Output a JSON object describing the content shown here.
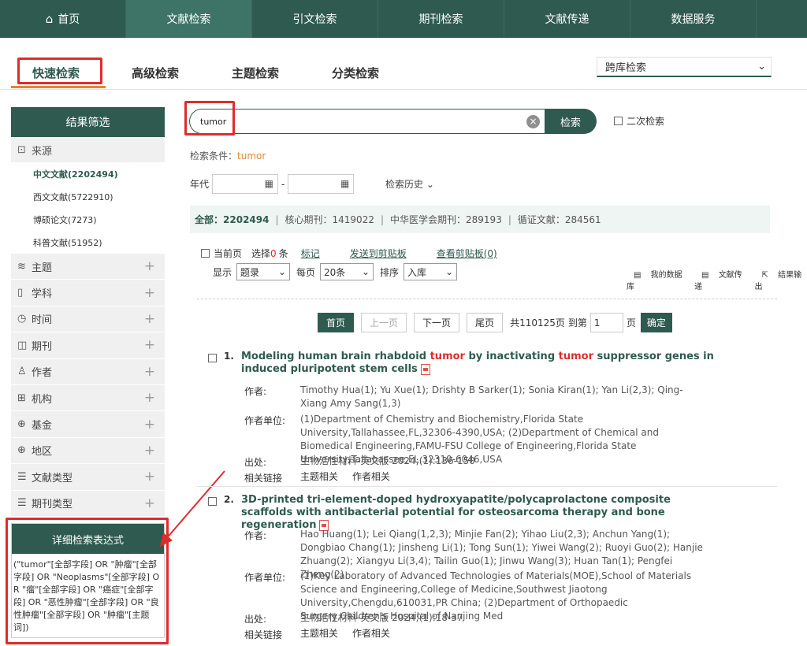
{
  "nav": {
    "items": [
      "首页",
      "文献检索",
      "引文检索",
      "期刊检索",
      "文献传递",
      "数据服务"
    ],
    "active": 1
  },
  "tabs": [
    "快速检索",
    "高级检索",
    "主题检索",
    "分类检索"
  ],
  "db_select": "跨库检索",
  "search": {
    "value": "tumor",
    "button": "检索",
    "secondary": "二次检索"
  },
  "condition": {
    "label": "检索条件：",
    "keyword": "tumor"
  },
  "year": {
    "label": "年代",
    "dash": "-"
  },
  "history": "检索历史",
  "stats": {
    "all_label": "全部：",
    "all": "2202494",
    "core": "核心期刊：1419022",
    "cma": "中华医学会期刊：289193",
    "evidence": "循证文献：284561"
  },
  "ops": {
    "current_page": "当前页",
    "selected_prefix": "选择",
    "selected_count": "0",
    "selected_suffix": "条",
    "mark": "标记",
    "send_clip": "发送到剪贴板",
    "view_clip": "查看剪贴板(0)",
    "display_label": "显示",
    "display_val": "题录",
    "perpage_label": "每页",
    "perpage_val": "20条",
    "sort_label": "排序",
    "sort_val": "入库",
    "my_db": "我的数据库",
    "doc_delivery": "文献传递",
    "export": "结果输出"
  },
  "pager": {
    "first": "首页",
    "prev": "上一页",
    "next": "下一页",
    "last": "尾页",
    "total": "共110125页",
    "goto": "到第",
    "page_val": "1",
    "page_unit": "页",
    "ok": "确定"
  },
  "sidebar": {
    "title": "结果筛选",
    "source": "来源",
    "sources": [
      "中文文献(2202494)",
      "西文文献(5722910)",
      "博硕论文(7273)",
      "科普文献(51952)"
    ],
    "cats": [
      {
        "label": "主题",
        "icon": "layers-icon"
      },
      {
        "label": "学科",
        "icon": "book-icon"
      },
      {
        "label": "时间",
        "icon": "clock-icon"
      },
      {
        "label": "期刊",
        "icon": "open-book-icon"
      },
      {
        "label": "作者",
        "icon": "person-icon"
      },
      {
        "label": "机构",
        "icon": "building-icon"
      },
      {
        "label": "基金",
        "icon": "globe-icon"
      },
      {
        "label": "地区",
        "icon": "region-icon"
      },
      {
        "label": "文献类型",
        "icon": "list-icon"
      },
      {
        "label": "期刊类型",
        "icon": "list-icon"
      }
    ]
  },
  "expression": {
    "title": "详细检索表达式",
    "text": "(\"tumor\"[全部字段] OR \"肿瘤\"[全部字段] OR \"Neoplasms\"[全部字段] OR \"瘤\"[全部字段] OR \"癌症\"[全部字段] OR \"恶性肿瘤\"[全部字段] OR \"良性肿瘤\"[全部字段] OR \"肿瘤\"[主题词])"
  },
  "results": [
    {
      "num": "1.",
      "title_pre": "Modeling human brain rhabdoid ",
      "hl1": "tumor",
      "title_mid": " by inactivating ",
      "hl2": "tumor",
      "title_post": " suppressor genes in induced pluripotent stem cells",
      "author_label": "作者:",
      "authors": "Timothy Hua(1); Yu Xue(1); Drishty B Sarker(1); Sonia Kiran(1); Yan Li(2,3); Qing-Xiang Amy Sang(1,3)",
      "org_label": "作者单位:",
      "org": "(1)Department of Chemistry and Biochemistry,Florida State University,Tallahassee,FL,32306-4390,USA; (2)Department of Chemical and Biomedical Engineering,FAMU-FSU College of Engineering,Florida State University,Tallahassee,FL,32310-6046,USA",
      "src_label": "出处:",
      "src": "生物活性材料-英文版 2024;(1):136-150",
      "rel_label": "相关链接",
      "rel1": "主题相关",
      "rel2": "作者相关"
    },
    {
      "num": "2.",
      "title": "3D-printed tri-element-doped hydroxyapatite/polycaprolactone composite scaffolds with antibacterial potential for osteosarcoma therapy and bone regeneration",
      "author_label": "作者:",
      "authors": "Hao Huang(1); Lei Qiang(1,2,3); Minjie Fan(2); Yihao Liu(2,3); Anchun Yang(1); Dongbiao Chang(1); Jinsheng Li(1); Tong Sun(1); Yiwei Wang(2); Ruoyi Guo(2); Hanjie Zhuang(2); Xiangyu Li(3,4); Tailin Guo(1); Jinwu Wang(3); Huan Tan(1); Pengfei Zheng(2)",
      "org_label": "作者单位:",
      "org": "(1)Key Laboratory of Advanced Technologies of Materials(MOE),School of Materials Science and Engineering,College of Medicine,Southwest Jiaotong University,Chengdu,610031,PR China; (2)Department of Orthopaedic Surgery,Children's Hospital of Nanjing Med",
      "src_label": "出处:",
      "src": "生物活性材料-英文版 2024;(1):18-37",
      "rel_label": "相关链接",
      "rel1": "主题相关",
      "rel2": "作者相关"
    }
  ],
  "colors": {
    "primary": "#2f5a4f",
    "accent": "#e78434",
    "highlight": "#e02b2b"
  }
}
